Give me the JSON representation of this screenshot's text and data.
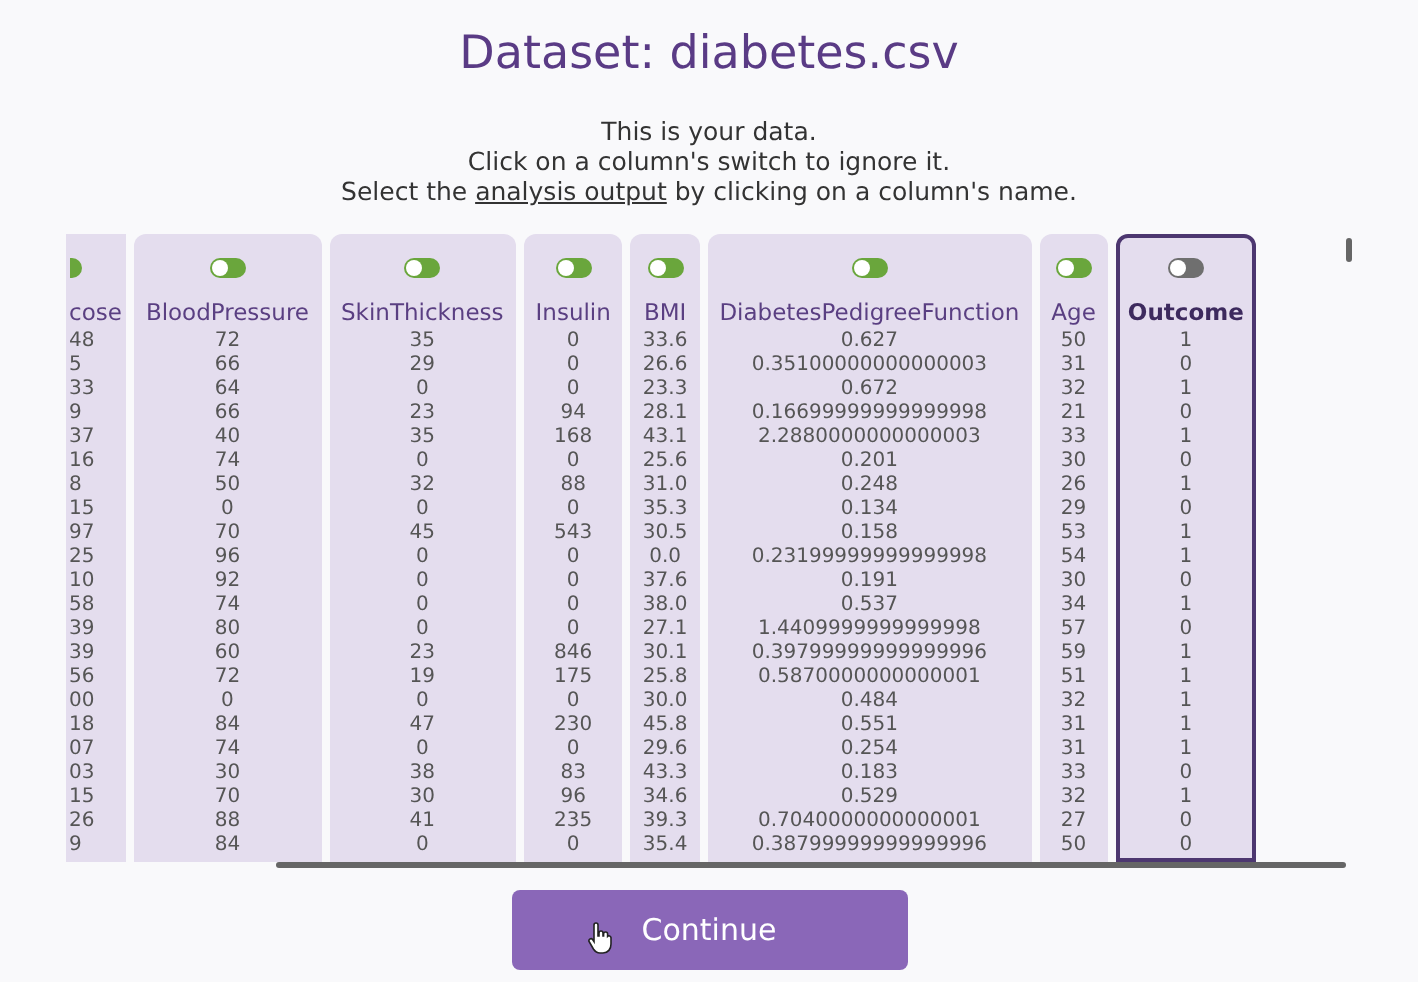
{
  "title": "Dataset: diabetes.csv",
  "instructions": {
    "lines": [
      "This is your data.",
      "Click on a column's switch to ignore it."
    ],
    "prefix": "Select the ",
    "link": "analysis output",
    "suffix": " by clicking on a column's name."
  },
  "columns": [
    {
      "name": "cose",
      "disabled": false,
      "selected": false,
      "values": [
        "48",
        "5",
        "33",
        "9",
        "37",
        "16",
        "8",
        "15",
        "97",
        "25",
        "10",
        "58",
        "39",
        "39",
        "56",
        "00",
        "18",
        "07",
        "03",
        "15",
        "26",
        "9"
      ]
    },
    {
      "name": "BloodPressure",
      "disabled": false,
      "selected": false,
      "values": [
        "72",
        "66",
        "64",
        "66",
        "40",
        "74",
        "50",
        "0",
        "70",
        "96",
        "92",
        "74",
        "80",
        "60",
        "72",
        "0",
        "84",
        "74",
        "30",
        "70",
        "88",
        "84"
      ]
    },
    {
      "name": "SkinThickness",
      "disabled": false,
      "selected": false,
      "values": [
        "35",
        "29",
        "0",
        "23",
        "35",
        "0",
        "32",
        "0",
        "45",
        "0",
        "0",
        "0",
        "0",
        "23",
        "19",
        "0",
        "47",
        "0",
        "38",
        "30",
        "41",
        "0"
      ]
    },
    {
      "name": "Insulin",
      "disabled": false,
      "selected": false,
      "values": [
        "0",
        "0",
        "0",
        "94",
        "168",
        "0",
        "88",
        "0",
        "543",
        "0",
        "0",
        "0",
        "0",
        "846",
        "175",
        "0",
        "230",
        "0",
        "83",
        "96",
        "235",
        "0"
      ]
    },
    {
      "name": "BMI",
      "disabled": false,
      "selected": false,
      "values": [
        "33.6",
        "26.6",
        "23.3",
        "28.1",
        "43.1",
        "25.6",
        "31.0",
        "35.3",
        "30.5",
        "0.0",
        "37.6",
        "38.0",
        "27.1",
        "30.1",
        "25.8",
        "30.0",
        "45.8",
        "29.6",
        "43.3",
        "34.6",
        "39.3",
        "35.4"
      ]
    },
    {
      "name": "DiabetesPedigreeFunction",
      "disabled": false,
      "selected": false,
      "values": [
        "0.627",
        "0.35100000000000003",
        "0.672",
        "0.16699999999999998",
        "2.2880000000000003",
        "0.201",
        "0.248",
        "0.134",
        "0.158",
        "0.23199999999999998",
        "0.191",
        "0.537",
        "1.4409999999999998",
        "0.39799999999999996",
        "0.5870000000000001",
        "0.484",
        "0.551",
        "0.254",
        "0.183",
        "0.529",
        "0.7040000000000001",
        "0.38799999999999996"
      ]
    },
    {
      "name": "Age",
      "disabled": false,
      "selected": false,
      "values": [
        "50",
        "31",
        "32",
        "21",
        "33",
        "30",
        "26",
        "29",
        "53",
        "54",
        "30",
        "34",
        "57",
        "59",
        "51",
        "32",
        "31",
        "31",
        "33",
        "32",
        "27",
        "50"
      ]
    },
    {
      "name": "Outcome",
      "disabled": true,
      "selected": true,
      "values": [
        "1",
        "0",
        "1",
        "0",
        "1",
        "0",
        "1",
        "0",
        "1",
        "1",
        "0",
        "1",
        "0",
        "1",
        "1",
        "1",
        "1",
        "1",
        "0",
        "1",
        "0",
        "0"
      ]
    }
  ],
  "button": "Continue"
}
